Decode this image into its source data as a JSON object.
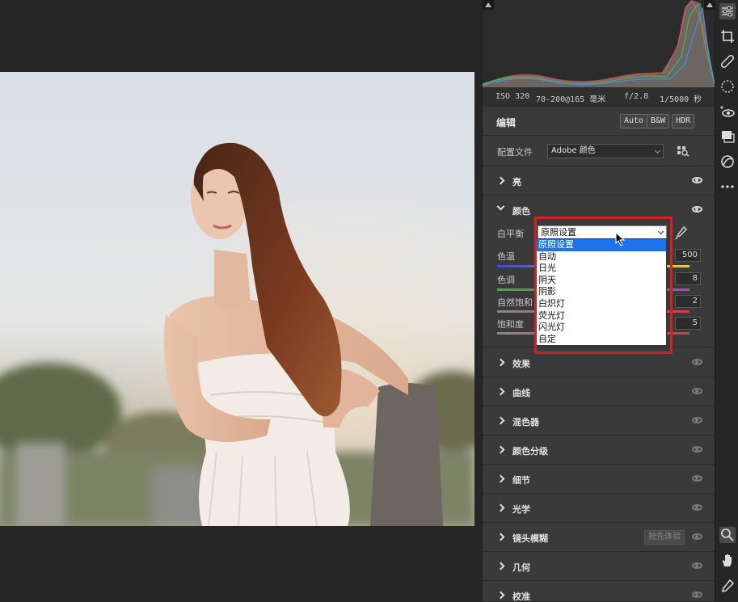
{
  "exif": {
    "iso": "ISO 320",
    "lens": "70-200@165 毫米",
    "aperture": "f/2.8",
    "shutter": "1/5000 秒"
  },
  "edit": {
    "title": "编辑",
    "auto_label": "Auto",
    "bw_label": "B&W",
    "hdr_label": "HDR"
  },
  "profile": {
    "label": "配置文件",
    "value": "Adobe 颜色"
  },
  "sections": {
    "light": "亮",
    "color": "颜色",
    "effects": "效果",
    "curve": "曲线",
    "mixer": "混色器",
    "grading": "颜色分级",
    "detail": "细节",
    "optics": "光学",
    "lens_blur": "镜头模糊",
    "lens_blur_badge": "抢先体验",
    "geometry": "几何",
    "calibration": "校准"
  },
  "color_panel": {
    "wb_label": "白平衡",
    "wb_value": "原照设置",
    "temp_label": "色温",
    "temp_value": "500",
    "tint_label": "色调",
    "tint_value": "8",
    "vibrance_label": "自然饱和",
    "vibrance_value": "2",
    "saturation_label": "饱和度",
    "saturation_value": "5"
  },
  "wb_options": [
    "原照设置",
    "自动",
    "日光",
    "阴天",
    "阴影",
    "白炽灯",
    "荧光灯",
    "闪光灯",
    "自定"
  ],
  "colors": {
    "highlight": "#1e73e8",
    "annotation": "#d42020",
    "panel": "#393939"
  }
}
